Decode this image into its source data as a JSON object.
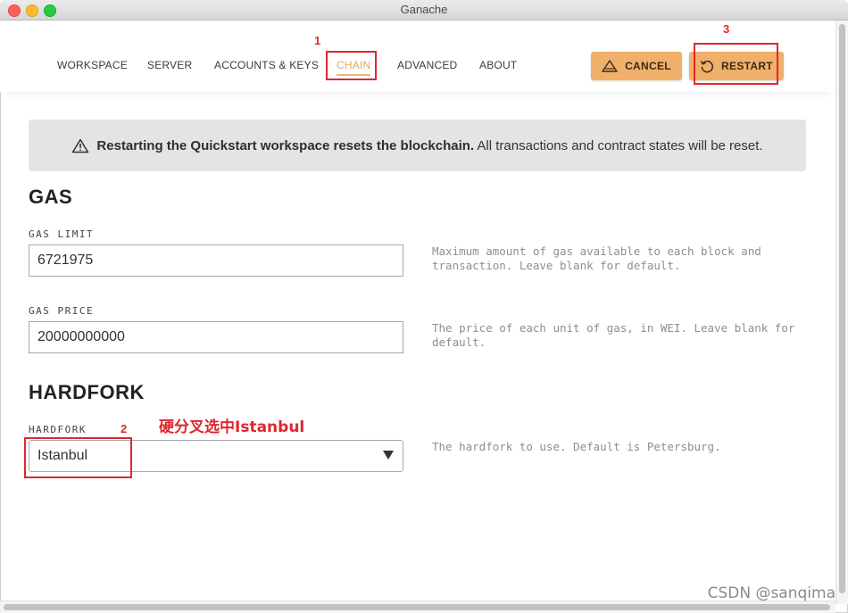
{
  "window": {
    "title": "Ganache"
  },
  "nav": {
    "items": [
      {
        "label": "WORKSPACE"
      },
      {
        "label": "SERVER"
      },
      {
        "label": "ACCOUNTS & KEYS"
      },
      {
        "label": "CHAIN"
      },
      {
        "label": "ADVANCED"
      },
      {
        "label": "ABOUT"
      }
    ],
    "active": "CHAIN",
    "cancel_label": "CANCEL",
    "restart_label": "RESTART"
  },
  "banner": {
    "bold": "Restarting the Quickstart workspace resets the blockchain.",
    "text": "All transactions and contract states will be reset."
  },
  "gas": {
    "title": "GAS",
    "limit_label": "GAS LIMIT",
    "limit_value": "6721975",
    "limit_help": "Maximum amount of gas available to each block and transaction. Leave blank for default.",
    "price_label": "GAS PRICE",
    "price_value": "20000000000",
    "price_help": "The price of each unit of gas, in WEI. Leave blank for default."
  },
  "hardfork": {
    "title": "HARDFORK",
    "label": "HARDFORK",
    "selected": "Istanbul",
    "help": "The hardfork to use. Default is Petersburg."
  },
  "annotations": {
    "num1": "1",
    "num2": "2",
    "num3": "3",
    "note": "硬分叉选中Istanbul"
  },
  "watermark": "CSDN @sanqima",
  "colors": {
    "accent": "#f0b06a",
    "active_tab": "#e4a663",
    "annotation": "#e0262d",
    "banner_bg": "#e4e4e4"
  }
}
